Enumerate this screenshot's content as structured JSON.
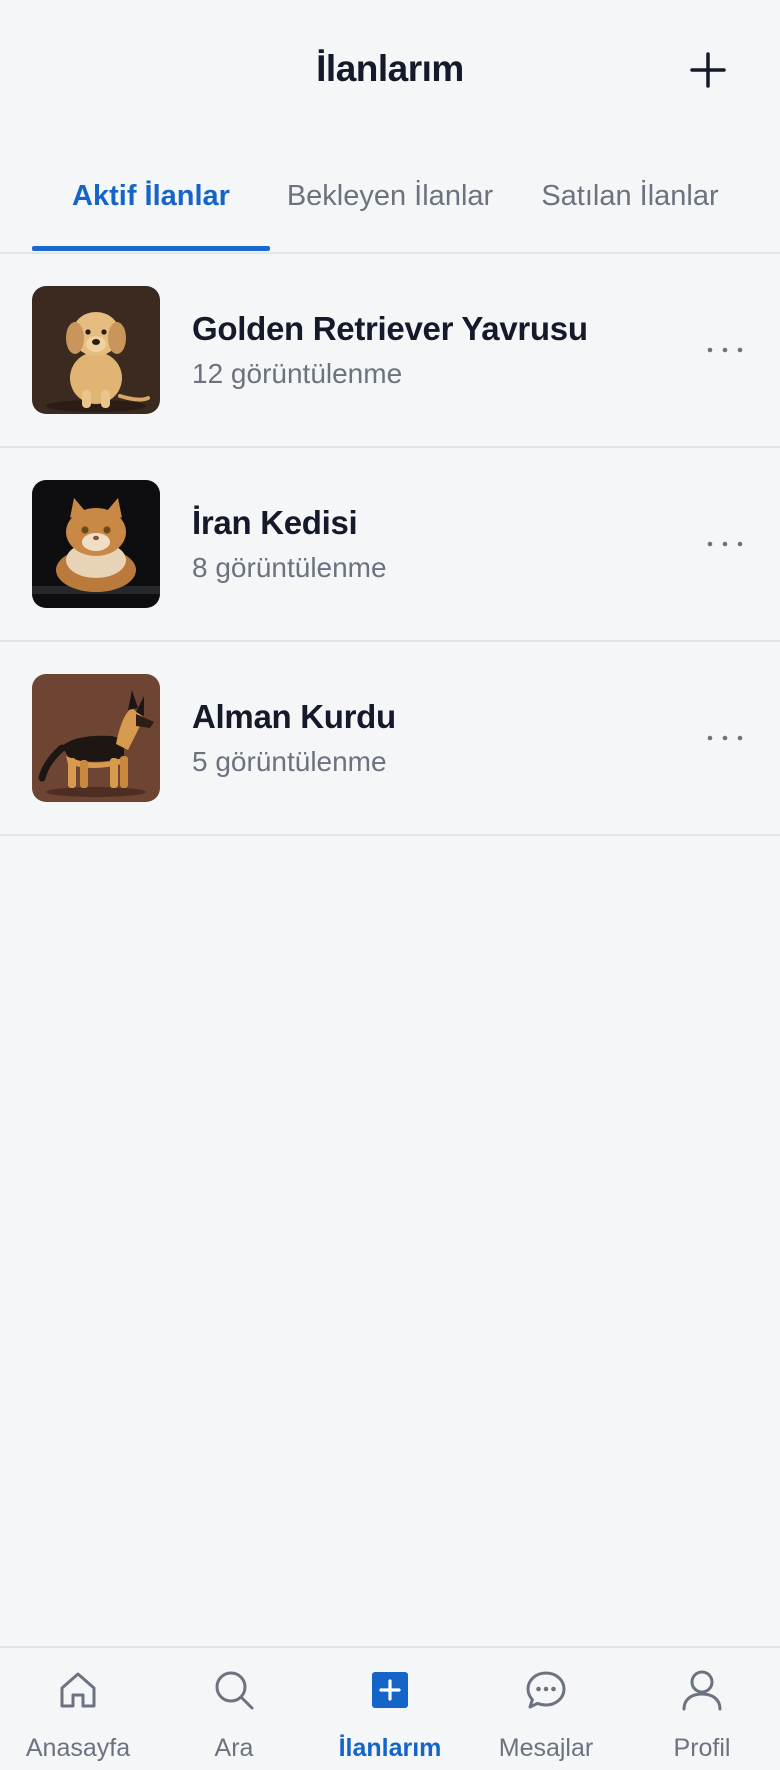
{
  "header": {
    "title": "İlanlarım",
    "add_icon": "plus-icon"
  },
  "tabs": [
    {
      "label": "Aktif İlanlar",
      "active": true
    },
    {
      "label": "Bekleyen İlanlar",
      "active": false
    },
    {
      "label": "Satılan İlanlar",
      "active": false
    }
  ],
  "listings": [
    {
      "title": "Golden Retriever Yavrusu",
      "views": "12 görüntülenme",
      "image": "golden-retriever-puppy-photo"
    },
    {
      "title": "İran Kedisi",
      "views": "8 görüntülenme",
      "image": "persian-cat-photo"
    },
    {
      "title": "Alman Kurdu",
      "views": "5 görüntülenme",
      "image": "german-shepherd-photo"
    }
  ],
  "bottom_nav": [
    {
      "label": "Anasayfa",
      "icon": "home-icon",
      "active": false
    },
    {
      "label": "Ara",
      "icon": "search-icon",
      "active": false
    },
    {
      "label": "İlanlarım",
      "icon": "add-listing-icon",
      "active": true
    },
    {
      "label": "Mesajlar",
      "icon": "chat-icon",
      "active": false
    },
    {
      "label": "Profil",
      "icon": "user-icon",
      "active": false
    }
  ],
  "colors": {
    "accent": "#1565c8",
    "text": "#141a2a",
    "muted": "#6b7280",
    "background": "#f5f6f8"
  }
}
